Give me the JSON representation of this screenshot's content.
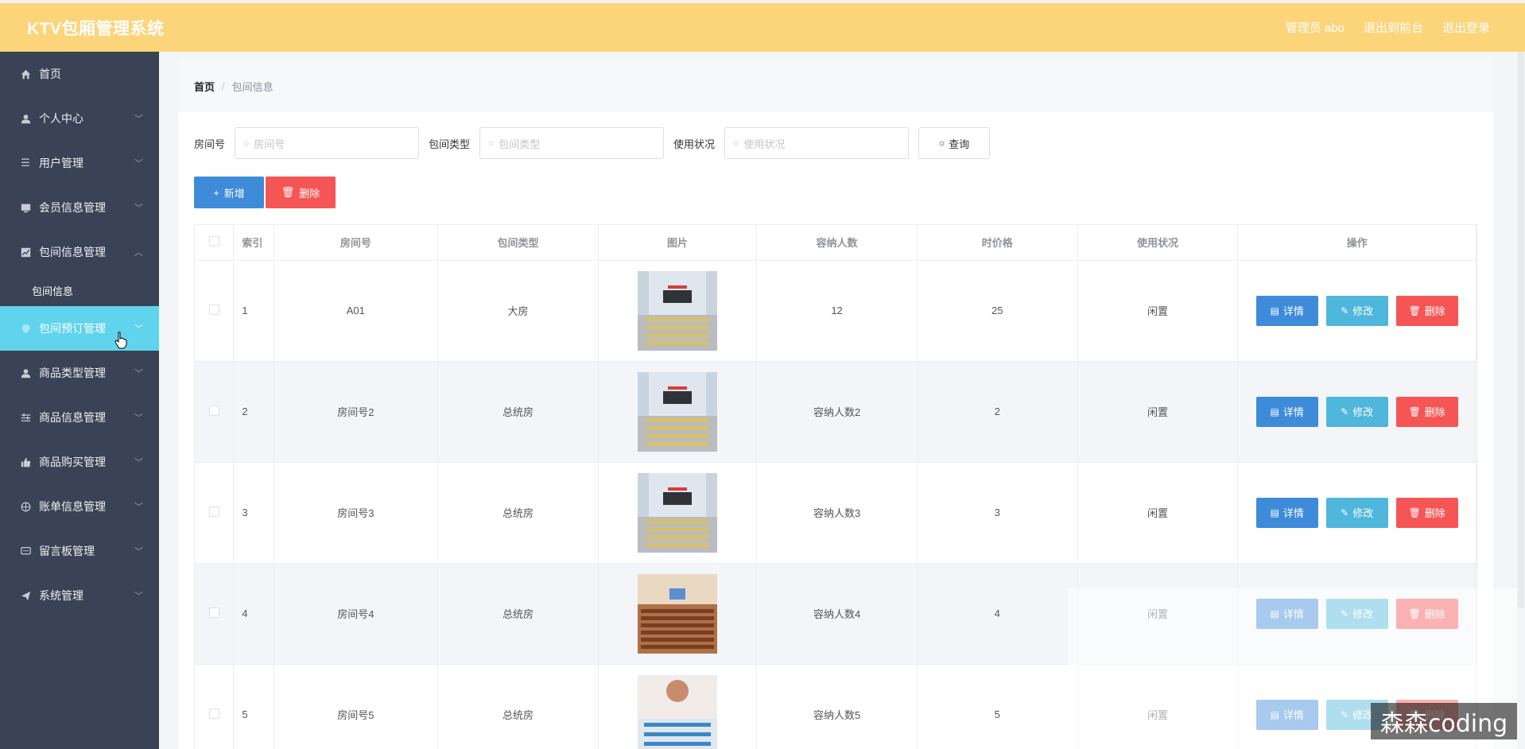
{
  "header": {
    "title": "KTV包厢管理系统",
    "links": [
      "管理员 abo",
      "退出到前台",
      "退出登录"
    ]
  },
  "sidebar": {
    "items": [
      {
        "label": "首页",
        "icon": "home-icon",
        "chevron": false
      },
      {
        "label": "个人中心",
        "icon": "person-icon",
        "chevron": true
      },
      {
        "label": "用户管理",
        "icon": "list-icon",
        "chevron": true
      },
      {
        "label": "会员信息管理",
        "icon": "monitor-icon",
        "chevron": true
      },
      {
        "label": "包间信息管理",
        "icon": "chart-icon",
        "chevron": true,
        "expanded": true
      },
      {
        "label": "包间预订管理",
        "icon": "pin-icon",
        "chevron": true,
        "active": true
      },
      {
        "label": "商品类型管理",
        "icon": "person-icon",
        "chevron": true
      },
      {
        "label": "商品信息管理",
        "icon": "sliders-icon",
        "chevron": true
      },
      {
        "label": "商品购买管理",
        "icon": "thumb-icon",
        "chevron": true
      },
      {
        "label": "账单信息管理",
        "icon": "globe-icon",
        "chevron": true
      },
      {
        "label": "留言板管理",
        "icon": "chat-icon",
        "chevron": true
      },
      {
        "label": "系统管理",
        "icon": "send-icon",
        "chevron": true
      }
    ],
    "submenu_label": "包间信息"
  },
  "breadcrumb": {
    "home": "首页",
    "current": "包间信息"
  },
  "search": {
    "room_label": "房间号",
    "room_placeholder": "房间号",
    "type_label": "包间类型",
    "type_placeholder": "包间类型",
    "status_label": "使用状况",
    "status_placeholder": "使用状况",
    "query_label": "查询"
  },
  "actions": {
    "add_label": "新增",
    "delete_label": "删除"
  },
  "table": {
    "columns": [
      "索引",
      "房间号",
      "包间类型",
      "图片",
      "容纳人数",
      "时价格",
      "使用状况",
      "操作"
    ],
    "rows": [
      {
        "index": "1",
        "room": "A01",
        "type": "大房",
        "capacity": "12",
        "price": "25",
        "status": "闲置",
        "image": "classroom"
      },
      {
        "index": "2",
        "room": "房间号2",
        "type": "总统房",
        "capacity": "容纳人数2",
        "price": "2",
        "status": "闲置",
        "image": "classroom"
      },
      {
        "index": "3",
        "room": "房间号3",
        "type": "总统房",
        "capacity": "容纳人数3",
        "price": "3",
        "status": "闲置",
        "image": "classroom"
      },
      {
        "index": "4",
        "room": "房间号4",
        "type": "总统房",
        "capacity": "容纳人数4",
        "price": "4",
        "status": "闲置",
        "image": "auditorium"
      },
      {
        "index": "5",
        "room": "房间号5",
        "type": "总统房",
        "capacity": "容纳人数5",
        "price": "5",
        "status": "闲置",
        "image": "lab"
      }
    ],
    "op_labels": {
      "detail": "详情",
      "edit": "修改",
      "delete": "删除"
    }
  },
  "watermark": "森森coding",
  "colors": {
    "header": "#fcd47a",
    "sidebar": "#3a4355",
    "active": "#60d4ec",
    "primary": "#3d8bd9",
    "info": "#4fb6dc",
    "danger": "#f65556"
  }
}
